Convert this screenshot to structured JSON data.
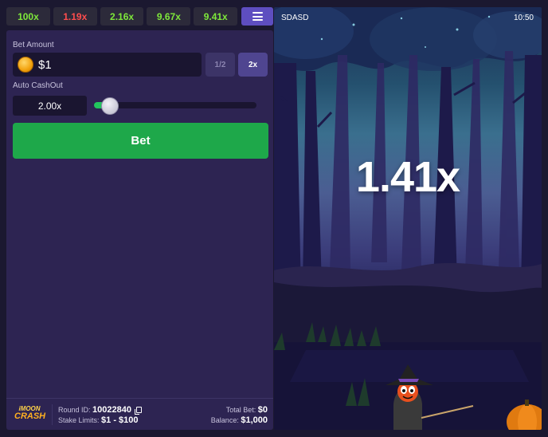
{
  "history": [
    {
      "value": "100x",
      "color": "#7ee83a"
    },
    {
      "value": "1.19x",
      "color": "#ff4d4d"
    },
    {
      "value": "2.16x",
      "color": "#7ee83a"
    },
    {
      "value": "9.67x",
      "color": "#7ee83a"
    },
    {
      "value": "9.41x",
      "color": "#7ee83a"
    }
  ],
  "menu_icon": "hamburger-icon",
  "bet": {
    "amount_label": "Bet Amount",
    "amount_value": "$1",
    "coin_icon": "coin-icon",
    "half_label": "1/2",
    "double_label": "2x",
    "auto_cashout_label": "Auto CashOut",
    "auto_cashout_value": "2.00x",
    "auto_cashout_slider_fraction": 0.05,
    "bet_button_label": "Bet"
  },
  "footer": {
    "logo_line1": "iMOON",
    "logo_line2": "CRASH",
    "round_id_label": "Round ID:",
    "round_id_value": "10022840",
    "stake_limits_label": "Stake Limits:",
    "stake_limits_value": "$1 - $100",
    "total_bet_label": "Total Bet:",
    "total_bet_value": "$0",
    "balance_label": "Balance:",
    "balance_value": "$1,000"
  },
  "game": {
    "player_name": "SDASD",
    "time": "10:50",
    "multiplier": "1.41x"
  },
  "colors": {
    "win": "#7ee83a",
    "loss": "#ff4d4d",
    "accent": "#5e4ec0",
    "bet_button": "#1ea84a",
    "panel": "#2d2452"
  }
}
